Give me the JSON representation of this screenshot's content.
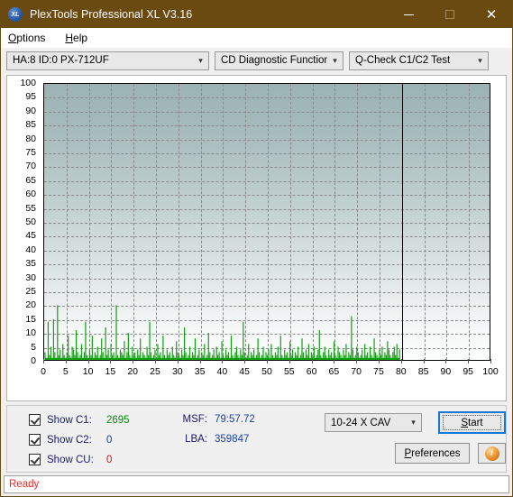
{
  "window": {
    "title": "PlexTools Professional XL V3.16",
    "icon": "xl-logo-icon",
    "titlebar_color": "#6b4a12",
    "minimize_label": "—",
    "maximize_label": "□",
    "close_label": "✕"
  },
  "menubar": {
    "items": [
      {
        "label": "Options",
        "accel": "O"
      },
      {
        "label": "Help",
        "accel": "H"
      }
    ]
  },
  "toolbar": {
    "drive_select": {
      "value": "HA:8 ID:0  PX-712UF"
    },
    "function_select": {
      "value": "CD Diagnostic Functions"
    },
    "test_select": {
      "value": "Q-Check C1/C2 Test"
    },
    "arrow": "⌄"
  },
  "chart_data": {
    "type": "line",
    "title": "",
    "xlabel": "",
    "ylabel": "",
    "xlim": [
      0,
      100
    ],
    "ylim": [
      0,
      100
    ],
    "grid": true,
    "legend_position": "none",
    "xticks": [
      0,
      5,
      10,
      15,
      20,
      25,
      30,
      35,
      40,
      45,
      50,
      55,
      60,
      65,
      70,
      75,
      80,
      85,
      90,
      95,
      100
    ],
    "yticks": [
      0,
      5,
      10,
      15,
      20,
      25,
      30,
      35,
      40,
      45,
      50,
      55,
      60,
      65,
      70,
      75,
      80,
      85,
      90,
      95,
      100
    ],
    "end_of_disc_marker": 80,
    "series": [
      {
        "name": "C1",
        "color": "#10a010",
        "total_errors": 2695,
        "x": [
          0.2,
          0.6,
          0.9,
          1.2,
          1.5,
          1.8,
          2.1,
          2.4,
          2.7,
          3.0,
          3.3,
          3.6,
          3.9,
          4.2,
          4.5,
          4.8,
          5.1,
          5.4,
          5.7,
          6.0,
          6.3,
          6.6,
          6.9,
          7.2,
          7.5,
          7.8,
          8.1,
          8.4,
          8.7,
          9.0,
          9.3,
          9.6,
          9.9,
          10.2,
          10.5,
          10.8,
          11.1,
          11.4,
          11.7,
          12.0,
          12.3,
          12.6,
          12.9,
          13.2,
          13.5,
          13.8,
          14.1,
          14.4,
          14.7,
          15.0,
          15.3,
          15.6,
          15.9,
          16.2,
          16.5,
          16.8,
          17.1,
          17.4,
          17.7,
          18.0,
          18.3,
          18.6,
          18.9,
          19.2,
          19.5,
          19.8,
          20.1,
          20.4,
          20.7,
          21.0,
          21.3,
          21.6,
          21.9,
          22.2,
          22.5,
          22.8,
          23.1,
          23.4,
          23.7,
          24.0,
          24.3,
          24.6,
          24.9,
          25.2,
          25.5,
          25.8,
          26.1,
          26.4,
          26.7,
          27.0,
          27.3,
          27.6,
          27.9,
          28.2,
          28.5,
          28.8,
          29.1,
          29.4,
          29.7,
          30.0,
          30.3,
          30.6,
          30.9,
          31.2,
          31.5,
          31.8,
          32.1,
          32.4,
          32.7,
          33.0,
          33.3,
          33.6,
          33.9,
          34.2,
          34.5,
          34.8,
          35.1,
          35.4,
          35.7,
          36.0,
          36.3,
          36.6,
          36.9,
          37.2,
          37.5,
          37.8,
          38.1,
          38.4,
          38.7,
          39.0,
          39.3,
          39.6,
          39.9,
          40.2,
          40.5,
          40.8,
          41.1,
          41.4,
          41.7,
          42.0,
          42.3,
          42.6,
          42.9,
          43.2,
          43.5,
          43.8,
          44.1,
          44.4,
          44.7,
          45.0,
          45.3,
          45.6,
          45.9,
          46.2,
          46.5,
          46.8,
          47.1,
          47.4,
          47.7,
          48.0,
          48.3,
          48.6,
          48.9,
          49.2,
          49.5,
          49.8,
          50.1,
          50.4,
          50.7,
          51.0,
          51.3,
          51.6,
          51.9,
          52.2,
          52.5,
          52.8,
          53.1,
          53.4,
          53.7,
          54.0,
          54.3,
          54.6,
          54.9,
          55.2,
          55.5,
          55.8,
          56.1,
          56.4,
          56.7,
          57.0,
          57.3,
          57.6,
          57.9,
          58.2,
          58.5,
          58.8,
          59.1,
          59.4,
          59.7,
          60.0,
          60.3,
          60.6,
          60.9,
          61.2,
          61.5,
          61.8,
          62.1,
          62.4,
          62.7,
          63.0,
          63.3,
          63.6,
          63.9,
          64.2,
          64.5,
          64.8,
          65.1,
          65.4,
          65.7,
          66.0,
          66.3,
          66.6,
          66.9,
          67.2,
          67.5,
          67.8,
          68.1,
          68.4,
          68.7,
          69.0,
          69.3,
          69.6,
          69.9,
          70.2,
          70.5,
          70.8,
          71.1,
          71.4,
          71.7,
          72.0,
          72.3,
          72.6,
          72.9,
          73.2,
          73.5,
          73.8,
          74.1,
          74.4,
          74.7,
          75.0,
          75.3,
          75.6,
          75.9,
          76.2,
          76.5,
          76.8,
          77.1,
          77.4,
          77.7,
          78.0,
          78.3,
          78.6,
          78.9,
          79.2,
          79.5,
          79.8
        ],
        "y": [
          3,
          1,
          14,
          2,
          5,
          1,
          15,
          3,
          1,
          20,
          2,
          4,
          1,
          6,
          2,
          1,
          3,
          9,
          2,
          1,
          5,
          4,
          2,
          11,
          3,
          1,
          2,
          6,
          1,
          3,
          14,
          2,
          1,
          4,
          2,
          9,
          1,
          3,
          2,
          5,
          1,
          2,
          8,
          3,
          1,
          12,
          2,
          4,
          1,
          6,
          2,
          3,
          1,
          20,
          2,
          1,
          4,
          3,
          2,
          7,
          1,
          3,
          10,
          2,
          1,
          5,
          2,
          3,
          1,
          4,
          2,
          8,
          1,
          3,
          2,
          1,
          5,
          2,
          14,
          3,
          1,
          2,
          4,
          1,
          6,
          2,
          3,
          1,
          9,
          2,
          1,
          4,
          2,
          3,
          1,
          5,
          2,
          1,
          7,
          3,
          2,
          1,
          4,
          2,
          12,
          3,
          1,
          2,
          5,
          1,
          3,
          2,
          8,
          1,
          2,
          4,
          1,
          3,
          2,
          6,
          1,
          2,
          10,
          3,
          1,
          2,
          4,
          1,
          5,
          2,
          3,
          1,
          7,
          2,
          1,
          4,
          2,
          3,
          1,
          9,
          2,
          1,
          3,
          5,
          2,
          1,
          4,
          2,
          14,
          3,
          1,
          2,
          6,
          1,
          3,
          2,
          4,
          1,
          2,
          8,
          3,
          1,
          2,
          5,
          1,
          3,
          2,
          4,
          1,
          6,
          2,
          1,
          3,
          2,
          5,
          1,
          9,
          2,
          1,
          4,
          2,
          3,
          1,
          7,
          2,
          4,
          1,
          3,
          2,
          5,
          1,
          2,
          8,
          3,
          1,
          4,
          2,
          6,
          1,
          3,
          2,
          5,
          1,
          2,
          4,
          11,
          2,
          1,
          3,
          5,
          2,
          1,
          4,
          2,
          3,
          1,
          7,
          2,
          1,
          5,
          3,
          2,
          1,
          4,
          2,
          6,
          1,
          3,
          2,
          16,
          4,
          1,
          2,
          5,
          3,
          1,
          2,
          4,
          1,
          6,
          2,
          3,
          1,
          5,
          2,
          1,
          8,
          3,
          2,
          1,
          4,
          2,
          5,
          1,
          3,
          2,
          7,
          4,
          2,
          1,
          3,
          5,
          2,
          6,
          1,
          4,
          2,
          3,
          1,
          5,
          2,
          8,
          3,
          1,
          2,
          4,
          6,
          3
        ]
      },
      {
        "name": "C2",
        "color": "#1a3faa",
        "total_errors": 0,
        "x": [],
        "y": []
      },
      {
        "name": "CU",
        "color": "#e01010",
        "total_errors": 0,
        "x": [],
        "y": []
      }
    ]
  },
  "controls": {
    "checkboxes": [
      {
        "name": "show-c1",
        "label": "Show C1:",
        "checked": true,
        "value": "2695",
        "color": "#0b8a0b"
      },
      {
        "name": "show-c2",
        "label": "Show C2:",
        "checked": true,
        "value": "0",
        "color": "#1a3faa"
      },
      {
        "name": "show-cu",
        "label": "Show CU:",
        "checked": true,
        "value": "0",
        "color": "#e01010"
      }
    ],
    "msf": {
      "label": "MSF:",
      "value": "79:57.72"
    },
    "lba": {
      "label": "LBA:",
      "value": "359847"
    },
    "speed_select": {
      "value": "10-24 X CAV"
    },
    "start_button": {
      "label": "Start",
      "accel": "S"
    },
    "preferences_button": {
      "label": "Preferences",
      "accel": "P"
    },
    "info_button": {
      "label": "i"
    }
  },
  "statusbar": {
    "text": "Ready"
  }
}
